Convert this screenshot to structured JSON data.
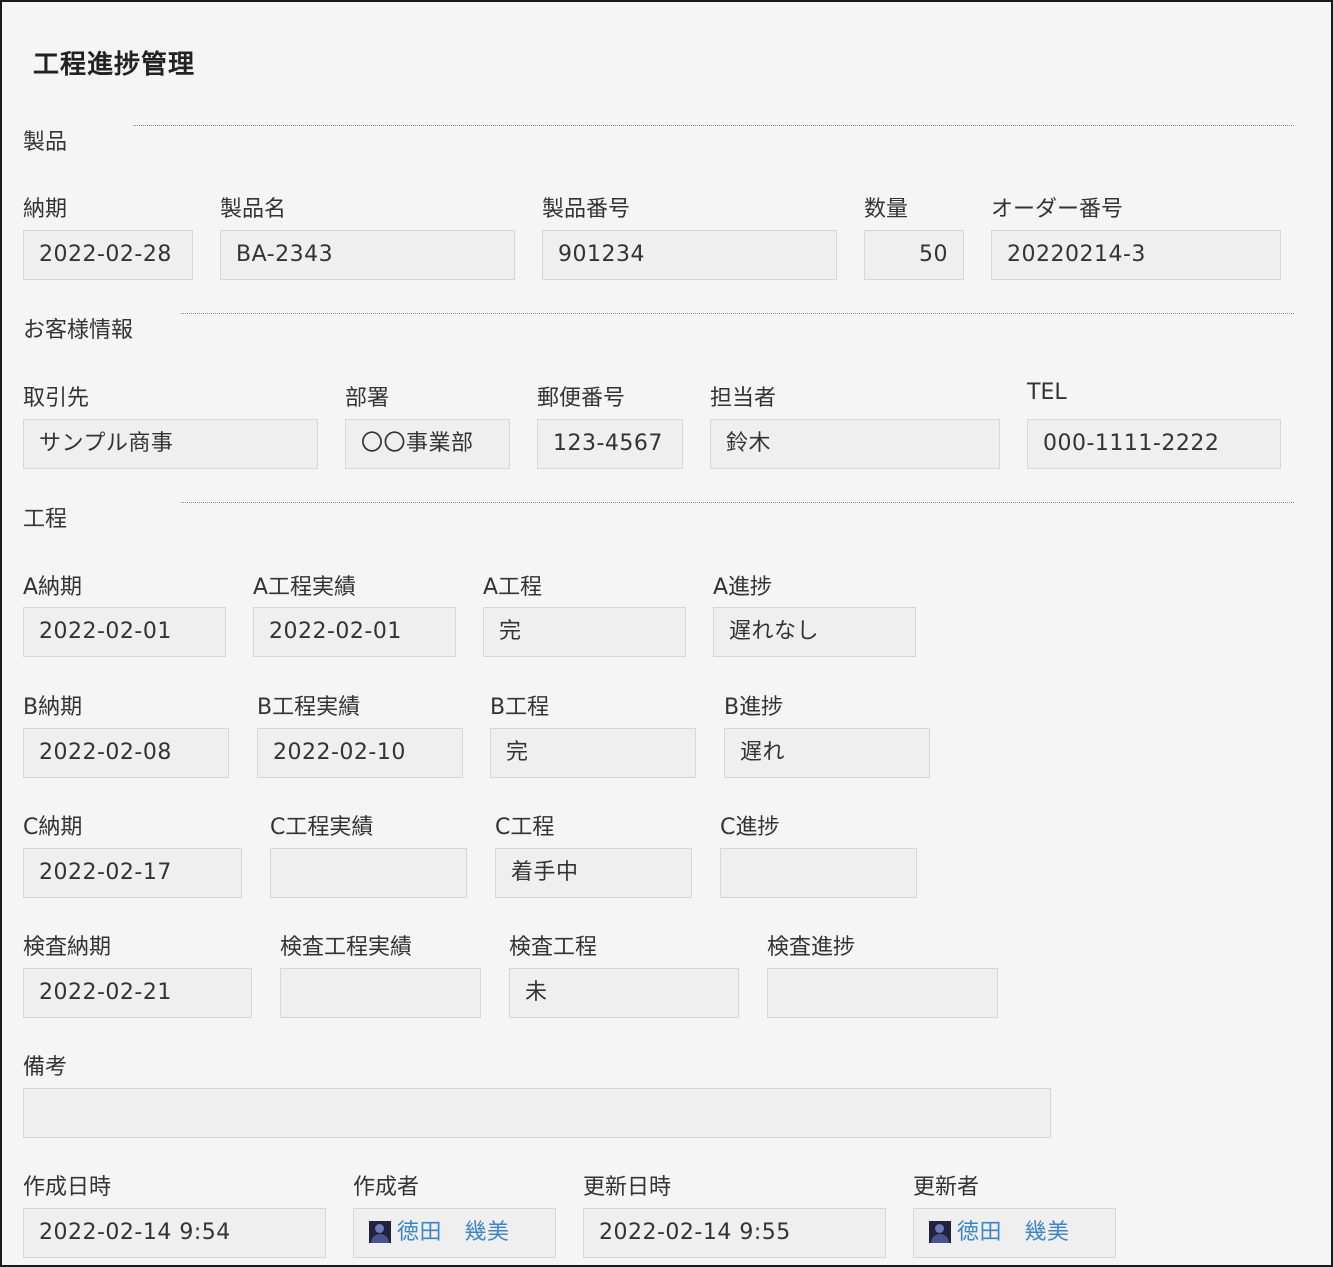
{
  "title": "工程進捗管理",
  "sections": {
    "product": "製品",
    "customer": "お客様情報",
    "process": "工程"
  },
  "product": {
    "due": {
      "label": "納期",
      "value": "2022-02-28"
    },
    "name": {
      "label": "製品名",
      "value": "BA-2343"
    },
    "number": {
      "label": "製品番号",
      "value": "901234"
    },
    "quantity": {
      "label": "数量",
      "value": "50"
    },
    "order": {
      "label": "オーダー番号",
      "value": "20220214-3"
    }
  },
  "customer": {
    "client": {
      "label": "取引先",
      "value": "サンプル商事"
    },
    "dept": {
      "label": "部署",
      "value": "〇〇事業部"
    },
    "postal": {
      "label": "郵便番号",
      "value": "123-4567"
    },
    "person": {
      "label": "担当者",
      "value": "鈴木"
    },
    "tel": {
      "label": "TEL",
      "value": "000-1111-2222"
    }
  },
  "process": {
    "a": {
      "due_label": "A納期",
      "due": "2022-02-01",
      "actual_label": "A工程実績",
      "actual": "2022-02-01",
      "status_label": "A工程",
      "status": "完",
      "progress_label": "A進捗",
      "progress": "遅れなし"
    },
    "b": {
      "due_label": "B納期",
      "due": "2022-02-08",
      "actual_label": "B工程実績",
      "actual": "2022-02-10",
      "status_label": "B工程",
      "status": "完",
      "progress_label": "B進捗",
      "progress": "遅れ"
    },
    "c": {
      "due_label": "C納期",
      "due": "2022-02-17",
      "actual_label": "C工程実績",
      "actual": "",
      "status_label": "C工程",
      "status": "着手中",
      "progress_label": "C進捗",
      "progress": ""
    },
    "inspect": {
      "due_label": "検査納期",
      "due": "2022-02-21",
      "actual_label": "検査工程実績",
      "actual": "",
      "status_label": "検査工程",
      "status": "未",
      "progress_label": "検査進捗",
      "progress": ""
    }
  },
  "remarks": {
    "label": "備考",
    "value": ""
  },
  "meta": {
    "created_label": "作成日時",
    "created": "2022-02-14 9:54",
    "creator_label": "作成者",
    "creator": "徳田　幾美",
    "updated_label": "更新日時",
    "updated": "2022-02-14 9:55",
    "updater_label": "更新者",
    "updater": "徳田　幾美"
  },
  "icons": {
    "user": "user-avatar-icon"
  },
  "colors": {
    "link": "#3a86c8",
    "field_bg": "#efefef",
    "page_bg": "#f5f5f5"
  }
}
